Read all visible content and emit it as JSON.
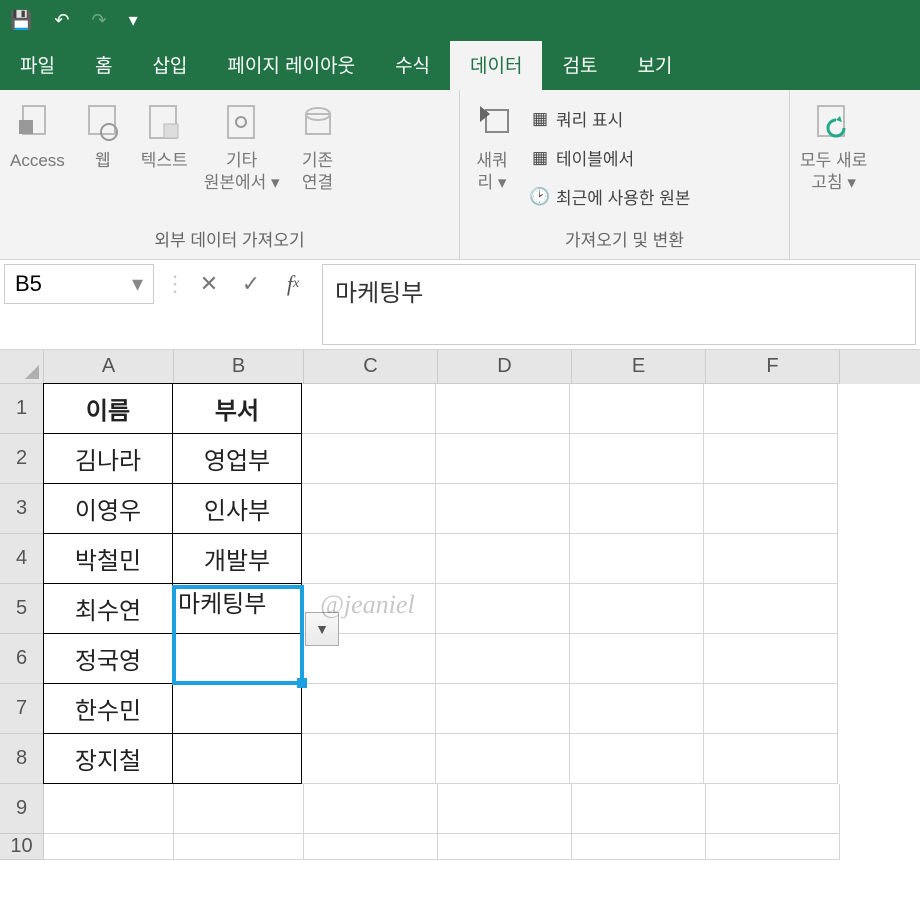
{
  "qat": {
    "save": "💾",
    "undo": "↶",
    "redo": "↷",
    "custom": "▾"
  },
  "tabs": [
    "파일",
    "홈",
    "삽입",
    "페이지 레이아웃",
    "수식",
    "데이터",
    "검토",
    "보기"
  ],
  "activeTab": 5,
  "ribbon": {
    "group1": {
      "label": "외부 데이터 가져오기",
      "items": [
        "Access",
        "웹",
        "텍스트",
        "기타\n원본에서 ▾",
        "기존\n연결"
      ]
    },
    "group2": {
      "label": "가져오기 및 변환",
      "items": [
        "새쿼\n리 ▾"
      ],
      "side": [
        "쿼리 표시",
        "테이블에서",
        "최근에 사용한 원본"
      ]
    },
    "group3": {
      "items": [
        "모두 새로\n고침 ▾"
      ]
    }
  },
  "namebox": "B5",
  "formula": "마케팅부",
  "columns": [
    "A",
    "B",
    "C",
    "D",
    "E",
    "F"
  ],
  "rownums": [
    1,
    2,
    3,
    4,
    5,
    6,
    7,
    8,
    9,
    10
  ],
  "grid": {
    "r1": {
      "A": "이름",
      "B": "부서"
    },
    "r2": {
      "A": "김나라",
      "B": "영업부"
    },
    "r3": {
      "A": "이영우",
      "B": "인사부"
    },
    "r4": {
      "A": "박철민",
      "B": "개발부"
    },
    "r5": {
      "A": "최수연",
      "B": ""
    },
    "r6": {
      "A": "정국영",
      "B": ""
    },
    "r7": {
      "A": "한수민",
      "B": ""
    },
    "r8": {
      "A": "장지철",
      "B": ""
    }
  },
  "selectedCellText": "마케팅부",
  "watermark": "@jeaniel"
}
